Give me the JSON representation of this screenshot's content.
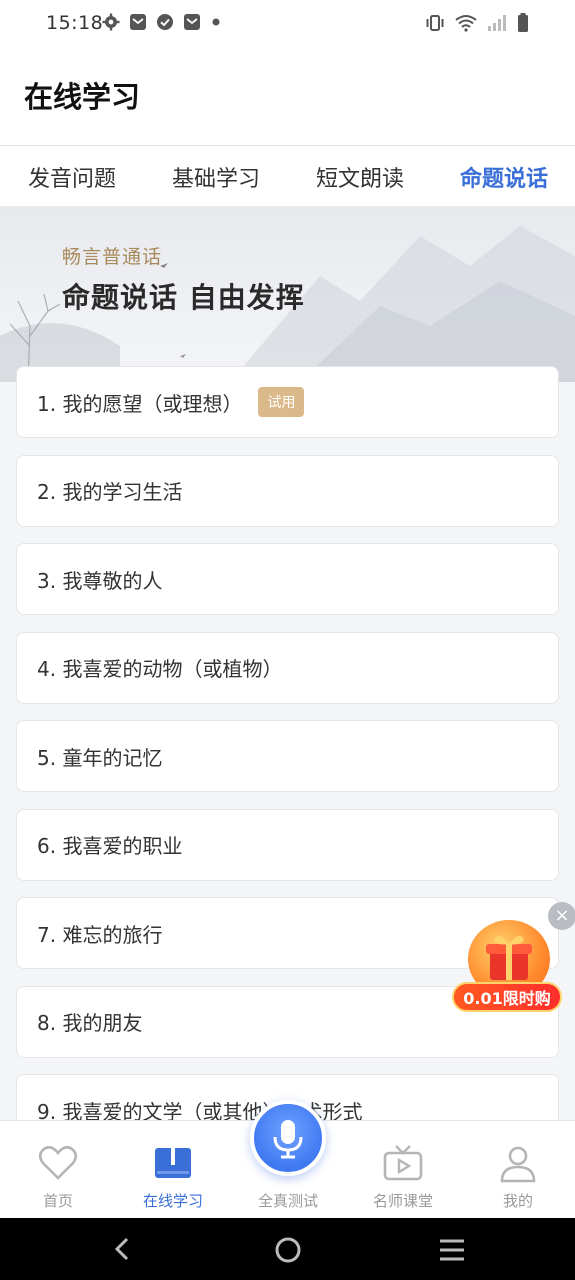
{
  "status_bar": {
    "time": "15:18",
    "left_icons": [
      "settings-icon",
      "mail-icon",
      "check-icon",
      "mail-icon",
      "dot-icon"
    ],
    "right_icons": [
      "vibrate-icon",
      "wifi-icon",
      "signal-icon",
      "battery-icon"
    ]
  },
  "header": {
    "title": "在线学习"
  },
  "tabs": [
    {
      "label": "发音问题",
      "active": false
    },
    {
      "label": "基础学习",
      "active": false
    },
    {
      "label": "短文朗读",
      "active": false
    },
    {
      "label": "命题说话",
      "active": true
    }
  ],
  "banner": {
    "subtitle": "畅言普通话",
    "headline": "命题说话 自由发挥"
  },
  "topics": [
    {
      "label": "1. 我的愿望（或理想）",
      "badge": "试用"
    },
    {
      "label": "2. 我的学习生活"
    },
    {
      "label": "3. 我尊敬的人"
    },
    {
      "label": "4. 我喜爱的动物（或植物）"
    },
    {
      "label": "5. 童年的记忆"
    },
    {
      "label": "6. 我喜爱的职业"
    },
    {
      "label": "7. 难忘的旅行"
    },
    {
      "label": "8. 我的朋友"
    },
    {
      "label": "9. 我喜爱的文学（或其他）艺术形式"
    }
  ],
  "promo": {
    "label": "0.01限时购",
    "close": "×"
  },
  "bottom_nav": [
    {
      "label": "首页",
      "icon": "heart-icon",
      "active": false
    },
    {
      "label": "在线学习",
      "icon": "book-icon",
      "active": true
    },
    {
      "label": "全真测试",
      "icon": "mic-icon",
      "active": false
    },
    {
      "label": "名师课堂",
      "icon": "tv-icon",
      "active": false
    },
    {
      "label": "我的",
      "icon": "user-icon",
      "active": false
    }
  ],
  "colors": {
    "accent": "#3a6fd8",
    "badge": "#dcb98a",
    "promo": "#ff3d2a"
  }
}
